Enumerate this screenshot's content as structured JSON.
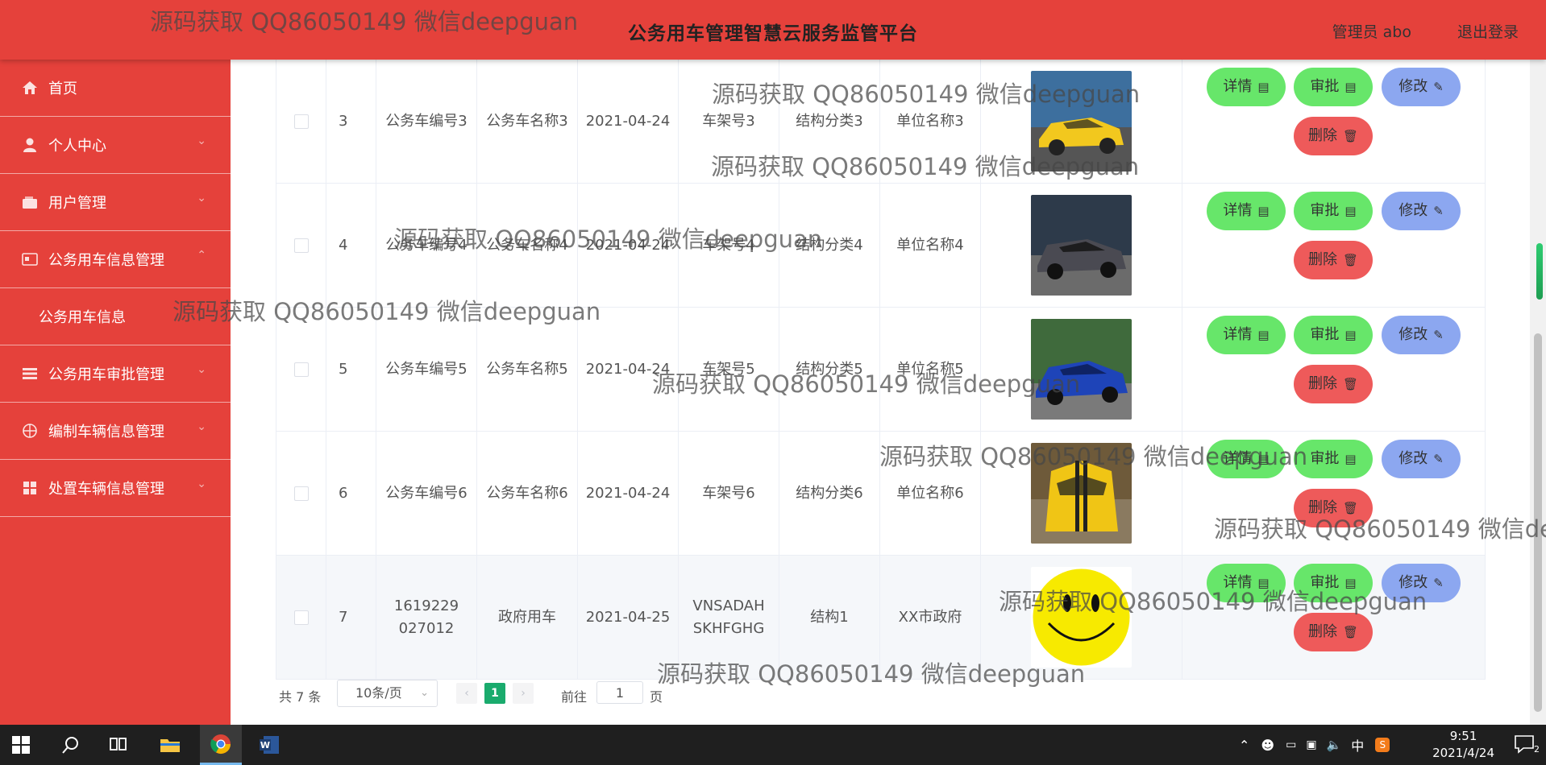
{
  "header": {
    "title": "公务用车管理智慧云服务监管平台",
    "user": "管理员 abo",
    "logout": "退出登录"
  },
  "sidebar": {
    "items": [
      {
        "label": "首页",
        "icon": "home-icon"
      },
      {
        "label": "个人中心",
        "icon": "user-icon"
      },
      {
        "label": "用户管理",
        "icon": "wallet-icon"
      },
      {
        "label": "公务用车信息管理",
        "icon": "card-icon"
      },
      {
        "label": "公务用车审批管理",
        "icon": "list-icon"
      },
      {
        "label": "编制车辆信息管理",
        "icon": "compass-icon"
      },
      {
        "label": "处置车辆信息管理",
        "icon": "grid-icon"
      }
    ],
    "submenu": [
      "公务用车信息"
    ]
  },
  "table": {
    "rows": [
      {
        "index": "3",
        "vehicle_no": "公务车编号3",
        "vehicle_name": "公务车名称3",
        "date": "2021-04-24",
        "frame_no": "车架号3",
        "classification": "结构分类3",
        "unit": "单位名称3",
        "image": "yellow-sports-car"
      },
      {
        "index": "4",
        "vehicle_no": "公务车编号4",
        "vehicle_name": "公务车名称4",
        "date": "2021-04-24",
        "frame_no": "车架号4",
        "classification": "结构分类4",
        "unit": "单位名称4",
        "image": "dark-sports-car"
      },
      {
        "index": "5",
        "vehicle_no": "公务车编号5",
        "vehicle_name": "公务车名称5",
        "date": "2021-04-24",
        "frame_no": "车架号5",
        "classification": "结构分类5",
        "unit": "单位名称5",
        "image": "blue-sports-car"
      },
      {
        "index": "6",
        "vehicle_no": "公务车编号6",
        "vehicle_name": "公务车名称6",
        "date": "2021-04-24",
        "frame_no": "车架号6",
        "classification": "结构分类6",
        "unit": "单位名称6",
        "image": "yellow-muscle-car"
      },
      {
        "index": "7",
        "vehicle_no": "1619229027012",
        "vehicle_name": "政府用车",
        "date": "2021-04-25",
        "frame_no": "VNSADAHSKHFGHG",
        "classification": "结构1",
        "unit": "XX市政府",
        "image": "smiley-face"
      }
    ],
    "actions": {
      "detail": "详情",
      "approve": "审批",
      "edit": "修改",
      "delete": "删除"
    }
  },
  "pagination": {
    "total": "共 7 条",
    "page_size": "10条/页",
    "current_page": "1",
    "goto_label": "前往",
    "goto_value": "1",
    "page_label": "页"
  },
  "watermark": "源码获取 QQ86050149 微信deepguan",
  "taskbar": {
    "clock_time": "9:51",
    "clock_date": "2021/4/24",
    "ime": "中",
    "notification_count": "2"
  },
  "colors": {
    "primary": "#e5413b",
    "green_button": "#67e66a",
    "blue_button": "#8ca7f0",
    "red_button": "#ee5a5a",
    "pager_active": "#1aab6d"
  }
}
